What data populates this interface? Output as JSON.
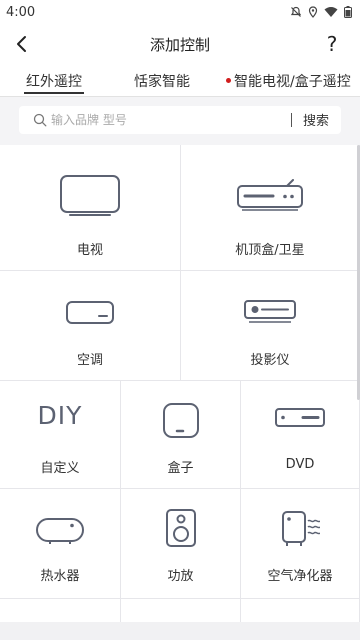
{
  "status_bar": {
    "time": "4:00"
  },
  "app_bar": {
    "title": "添加控制",
    "help": "?"
  },
  "tabs": [
    {
      "label": "红外遥控",
      "active": true
    },
    {
      "label": "恬家智能",
      "active": false
    },
    {
      "label": "智能电视/盒子遥控",
      "active": false,
      "dot_color": "#d11d1d"
    }
  ],
  "search": {
    "placeholder": "输入品牌 型号",
    "button": "搜索"
  },
  "devices": [
    {
      "label": "电视",
      "icon": "tv-icon"
    },
    {
      "label": "机顶盒/卫星",
      "icon": "set-top-box-icon"
    },
    {
      "label": "空调",
      "icon": "air-conditioner-icon"
    },
    {
      "label": "投影仪",
      "icon": "projector-icon"
    },
    {
      "label": "自定义",
      "icon": "diy-icon",
      "icon_text": "DIY"
    },
    {
      "label": "盒子",
      "icon": "box-icon"
    },
    {
      "label": "DVD",
      "icon": "dvd-icon"
    },
    {
      "label": "热水器",
      "icon": "water-heater-icon"
    },
    {
      "label": "功放",
      "icon": "amplifier-icon"
    },
    {
      "label": "空气净化器",
      "icon": "air-purifier-icon"
    }
  ],
  "colors": {
    "icon_stroke": "#5c6272",
    "grid_line": "#e6e6ea",
    "accent_dot": "#d11d1d"
  }
}
